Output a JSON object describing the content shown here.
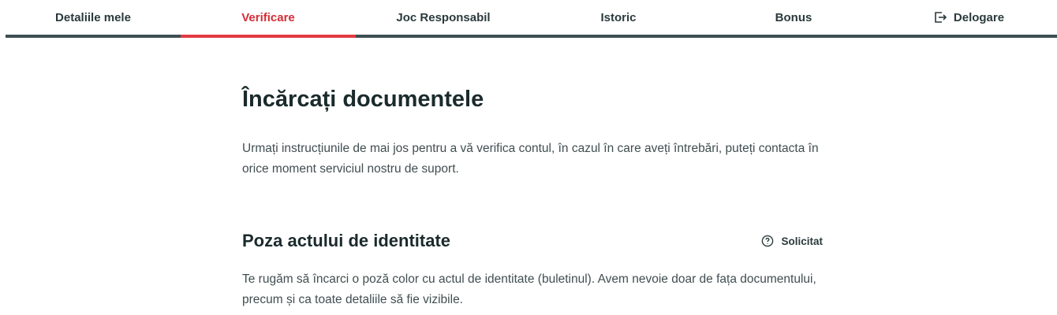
{
  "nav": {
    "tabs": [
      {
        "label": "Detaliile mele"
      },
      {
        "label": "Verificare"
      },
      {
        "label": "Joc Responsabil"
      },
      {
        "label": "Istoric"
      },
      {
        "label": "Bonus"
      },
      {
        "label": "Delogare",
        "icon": "logout-icon"
      }
    ],
    "active_tab": "Verificare"
  },
  "colors": {
    "accent": "#e33a41",
    "nav_border": "#3d4f51",
    "heading": "#1b2a2c",
    "body_text": "#414e50"
  },
  "main": {
    "title": "Încărcați documentele",
    "intro": "Urmați instrucțiunile de mai jos pentru a vă verifica contul, în cazul în care aveți întrebări, puteți contacta în orice moment serviciul nostru de suport."
  },
  "section": {
    "title": "Poza actului de identitate",
    "status_label": "Solicitat",
    "status_icon": "help-circle-icon",
    "description": "Te rugăm să încarci o poză color cu actul de identitate (buletinul). Avem nevoie doar de fața documentului, precum și ca toate detaliile să fie vizibile."
  }
}
